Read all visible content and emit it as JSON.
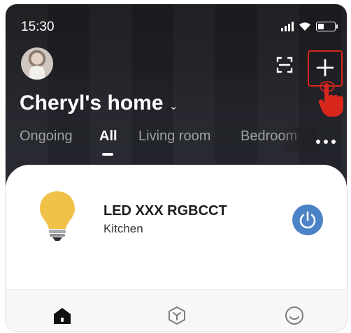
{
  "status_bar": {
    "time": "15:30",
    "icons": [
      "signal-icon",
      "wifi-icon",
      "battery-icon"
    ]
  },
  "header": {
    "avatar": "avatar",
    "actions": [
      "scan-icon",
      "plus-icon"
    ],
    "home_title": "Cheryl's home",
    "home_dropdown_icon": "chevron-down-icon"
  },
  "tabs": {
    "items": [
      {
        "label": "Ongoing",
        "active": false
      },
      {
        "label": "All",
        "active": true
      },
      {
        "label": "Living room",
        "active": false
      },
      {
        "label": "Bedroom",
        "active": false
      }
    ],
    "more_icon": "more-dots-icon"
  },
  "device": {
    "icon": "bulb-icon",
    "name": "LED XXX RGBCCT",
    "room": "Kitchen",
    "power_icon": "power-icon"
  },
  "bottom_nav": {
    "items": [
      {
        "icon": "home-icon",
        "active": true
      },
      {
        "icon": "scene-cube-icon",
        "active": false
      },
      {
        "icon": "profile-smile-icon",
        "active": false
      }
    ]
  },
  "colors": {
    "header_bg": "#1e1f24",
    "highlight_red": "#d9261c",
    "power_blue": "#4c82c6",
    "bulb_yellow": "#f1c24a"
  }
}
